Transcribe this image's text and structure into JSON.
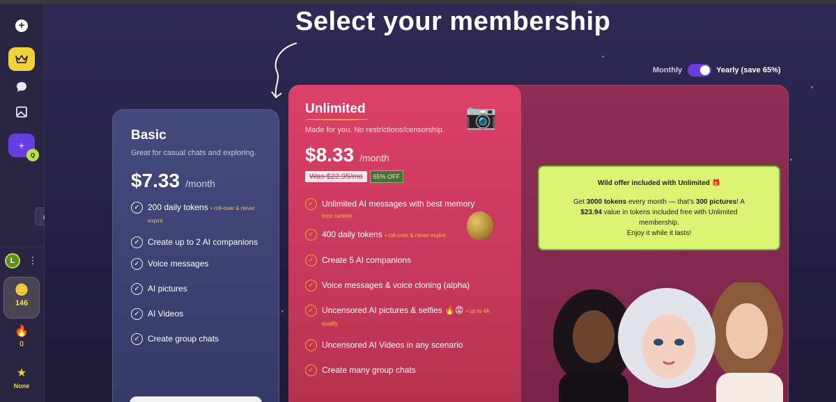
{
  "page": {
    "title": "Select your membership"
  },
  "sidebar": {
    "avatar_initial": "L",
    "stats": {
      "tokens": "146",
      "streak": "0",
      "tier": "None"
    }
  },
  "billing": {
    "monthly_label": "Monthly",
    "yearly_label": "Yearly (save 65%)",
    "selected": "yearly"
  },
  "basic": {
    "name": "Basic",
    "description": "Great for casual chats and exploring.",
    "price": "$7.33",
    "per": "/month",
    "features": [
      {
        "text": "200 daily tokens",
        "note": "• roll-over & never expire"
      },
      {
        "text": "Create up to 2 AI companions",
        "note": ""
      },
      {
        "text": "Voice messages",
        "note": ""
      },
      {
        "text": "AI pictures",
        "note": ""
      },
      {
        "text": "AI Videos",
        "note": ""
      },
      {
        "text": "Create group chats",
        "note": ""
      }
    ]
  },
  "unlimited": {
    "name": "Unlimited",
    "description": "Made for you. No restrictions/censorship.",
    "price": "$8.33",
    "per": "/month",
    "was": "Was $22.95/mo",
    "discount": "65% OFF",
    "features": [
      {
        "text": "Unlimited AI messages with best memory",
        "note": "best context"
      },
      {
        "text": "400 daily tokens",
        "note": "• roll-over & never expire"
      },
      {
        "text": "Create 5 AI companions",
        "note": ""
      },
      {
        "text": "Voice messages & voice cloning (alpha)",
        "note": ""
      },
      {
        "text": "Uncensored AI pictures & selfies 🔥😡",
        "note": "• up to 4K quality"
      },
      {
        "text": "Uncensored AI Videos in any scenario",
        "note": ""
      },
      {
        "text": "Create many group chats",
        "note": ""
      }
    ]
  },
  "offer": {
    "title": "Wild offer included with Unlimited",
    "line1_a": "Get ",
    "line1_b": "3000 tokens",
    "line1_c": " every month — that's ",
    "line1_d": "300 pictures",
    "line1_e": "! A",
    "line2_a": "$23.94",
    "line2_b": " value in tokens included free with Unlimited",
    "line3": "membership.",
    "line4": "Enjoy it while it lasts!"
  },
  "colors": {
    "accent": "#6a3de0",
    "unlimited": "#dc4168",
    "offer_bg": "#ddf373",
    "gold": "#f6a43a"
  }
}
